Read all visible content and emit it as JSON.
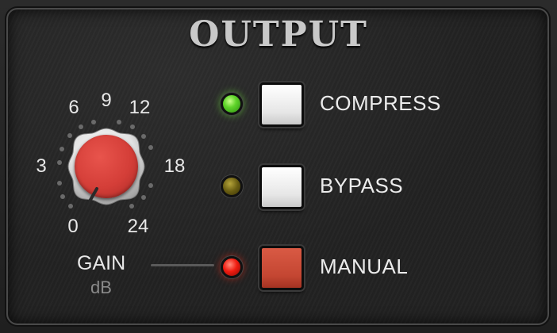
{
  "panel": {
    "title": "OUTPUT"
  },
  "gain": {
    "label": "GAIN",
    "unit": "dB",
    "scale": [
      "0",
      "3",
      "6",
      "9",
      "12",
      "18",
      "24"
    ],
    "knob_color": "#d43e38"
  },
  "buttons": [
    {
      "label": "COMPRESS",
      "led": "green",
      "led_color": "#5fd42a",
      "button_color": "#f0f0f0"
    },
    {
      "label": "BYPASS",
      "led": "yellow",
      "led_color": "#6a5e12",
      "button_color": "#f0f0f0"
    },
    {
      "label": "MANUAL",
      "led": "red",
      "led_color": "#f01c10",
      "button_color": "#c44632"
    }
  ]
}
